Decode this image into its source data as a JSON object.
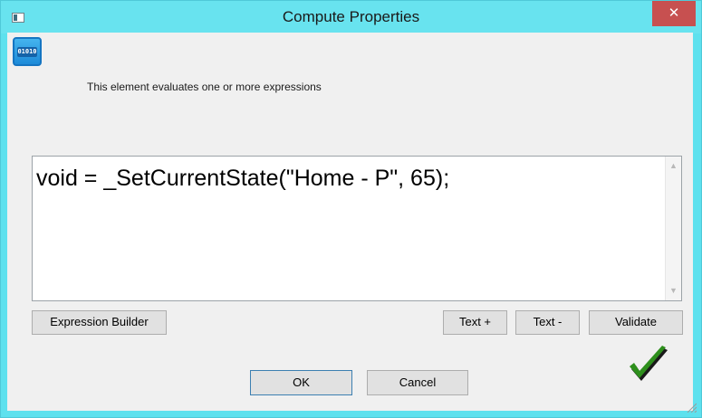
{
  "window": {
    "title": "Compute Properties",
    "close_glyph": "✕",
    "app_icon": "window-icon"
  },
  "header": {
    "icon": "binary-data-icon",
    "icon_text": "01010",
    "description": "This element evaluates one or more expressions"
  },
  "editor": {
    "text": "void = _SetCurrentState(\"Home - P\", 65);",
    "scroll_up_glyph": "▲",
    "scroll_down_glyph": "▼"
  },
  "toolbar": {
    "expression_builder_label": "Expression Builder",
    "text_plus_label": "Text +",
    "text_minus_label": "Text -",
    "validate_label": "Validate"
  },
  "footer": {
    "ok_label": "OK",
    "cancel_label": "Cancel",
    "status_icon": "green-checkmark-icon"
  },
  "colors": {
    "titlebar": "#68e3ef",
    "close_button": "#c75050",
    "dialog_background": "#f0f0f0",
    "checkmark": "#2e8f1c"
  }
}
